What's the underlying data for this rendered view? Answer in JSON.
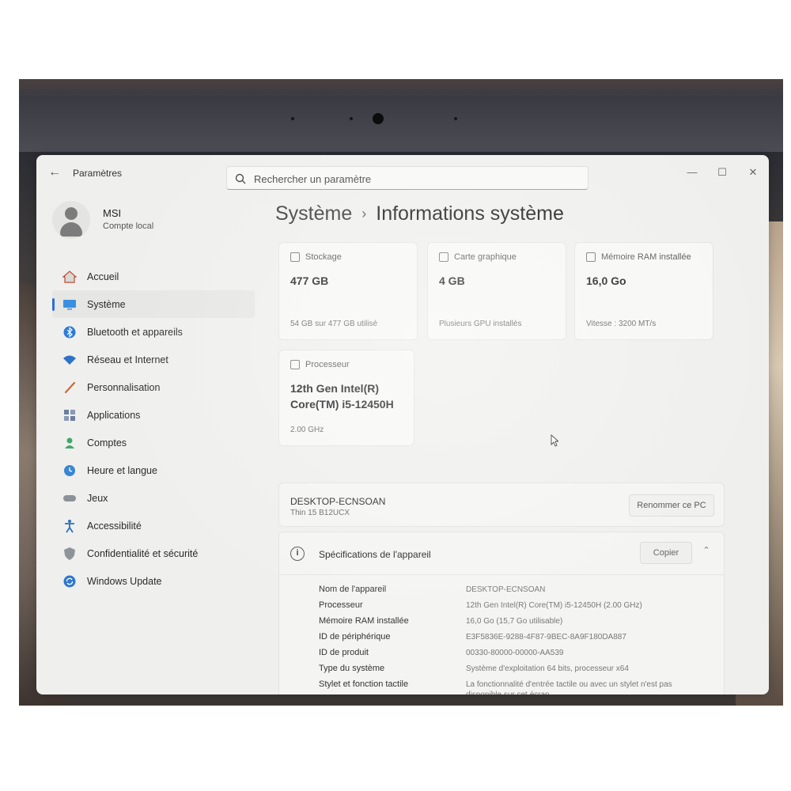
{
  "window": {
    "title": "Paramètres"
  },
  "search": {
    "placeholder": "Rechercher un paramètre"
  },
  "profile": {
    "name": "MSI",
    "account_type": "Compte local"
  },
  "sidebar": {
    "items": [
      {
        "label": "Accueil",
        "icon": "home-icon",
        "active": false
      },
      {
        "label": "Système",
        "icon": "system-icon",
        "active": true
      },
      {
        "label": "Bluetooth et appareils",
        "icon": "bluetooth-icon",
        "active": false
      },
      {
        "label": "Réseau et Internet",
        "icon": "wifi-icon",
        "active": false
      },
      {
        "label": "Personnalisation",
        "icon": "brush-icon",
        "active": false
      },
      {
        "label": "Applications",
        "icon": "apps-icon",
        "active": false
      },
      {
        "label": "Comptes",
        "icon": "accounts-icon",
        "active": false
      },
      {
        "label": "Heure et langue",
        "icon": "clock-globe-icon",
        "active": false
      },
      {
        "label": "Jeux",
        "icon": "gamepad-icon",
        "active": false
      },
      {
        "label": "Accessibilité",
        "icon": "accessibility-icon",
        "active": false
      },
      {
        "label": "Confidentialité et sécurité",
        "icon": "shield-icon",
        "active": false
      },
      {
        "label": "Windows Update",
        "icon": "update-icon",
        "active": false
      }
    ]
  },
  "breadcrumb": {
    "parent": "Système",
    "separator": "›",
    "current": "Informations système"
  },
  "cards": {
    "storage": {
      "title": "Stockage",
      "value": "477 GB",
      "footer": "54 GB sur 477 GB utilisé"
    },
    "gpu": {
      "title": "Carte graphique",
      "value": "4 GB",
      "footer": "Plusieurs GPU installés"
    },
    "ram": {
      "title": "Mémoire RAM installée",
      "value": "16,0 Go",
      "footer": "Vitesse : 3200 MT/s"
    },
    "cpu": {
      "title": "Processeur",
      "value_line1": "12th Gen Intel(R)",
      "value_line2": "Core(TM) i5-12450H",
      "footer": "2.00 GHz"
    }
  },
  "device": {
    "name": "DESKTOP-ECNSOAN",
    "model": "Thin 15 B12UCX",
    "rename_label": "Renommer ce PC"
  },
  "specs": {
    "title": "Spécifications de l'appareil",
    "copy_label": "Copier",
    "rows": [
      {
        "label": "Nom de l'appareil",
        "value": "DESKTOP-ECNSOAN"
      },
      {
        "label": "Processeur",
        "value": "12th Gen Intel(R) Core(TM) i5-12450H (2.00 GHz)"
      },
      {
        "label": "Mémoire RAM installée",
        "value": "16,0 Go (15,7 Go utilisable)"
      },
      {
        "label": "ID de périphérique",
        "value": "E3F5836E-9288-4F87-9BEC-8A9F180DA887"
      },
      {
        "label": "ID de produit",
        "value": "00330-80000-00000-AA539"
      },
      {
        "label": "Type du système",
        "value": "Système d'exploitation 64 bits, processeur x64"
      },
      {
        "label": "Stylet et fonction tactile",
        "value": "La fonctionnalité d'entrée tactile ou avec un stylet n'est pas disponible sur cet écran"
      }
    ]
  },
  "colors": {
    "accent": "#2f6fd6",
    "window_bg": "#efefed",
    "card_bg": "#f7f7f5"
  }
}
